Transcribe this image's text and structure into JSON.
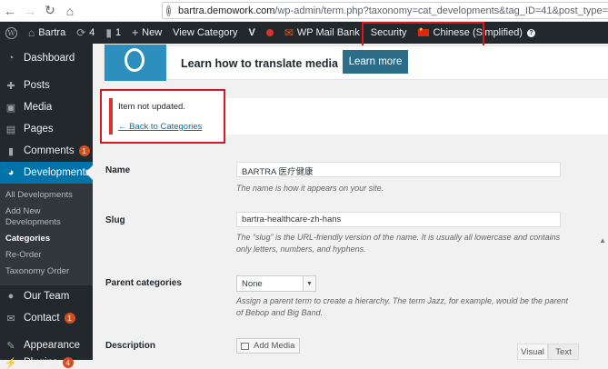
{
  "browser": {
    "url_host": "bartra.demowork.com",
    "url_path": "/wp-admin/term.php?taxonomy=cat_developments&tag_ID=41&post_type=developments"
  },
  "adminbar": {
    "site_name": "Bartra",
    "updates_count": "4",
    "comments_count": "1",
    "new_label": "New",
    "view_category": "View Category",
    "mail_bank": "WP Mail Bank",
    "security": "Security",
    "language": "Chinese (Simplified)"
  },
  "sidebar": {
    "dashboard": "Dashboard",
    "posts": "Posts",
    "media": "Media",
    "pages": "Pages",
    "comments": "Comments",
    "comments_badge": "1",
    "developments": "Developments",
    "sub": [
      "All Developments",
      "Add New Developments",
      "Categories",
      "Re-Order",
      "Taxonomy Order"
    ],
    "our_team": "Our Team",
    "contact": "Contact",
    "contact_badge": "1",
    "appearance": "Appearance",
    "plugins": "Plugins",
    "plugins_badge": "4"
  },
  "promo": {
    "text": "Learn how to translate media",
    "button": "Learn more"
  },
  "notice": {
    "message": "Item not updated.",
    "back_link": "← Back to Categories"
  },
  "form": {
    "name_label": "Name",
    "name_value": "BARTRA 医疗健康",
    "name_desc": "The name is how it appears on your site.",
    "slug_label": "Slug",
    "slug_value": "bartra-healthcare-zh-hans",
    "slug_desc_1": "The “slug” is the URL-friendly version of the name. It is usually all lowercase and contains",
    "slug_desc_2": "only letters, numbers, and hyphens.",
    "parent_label": "Parent categories",
    "parent_value": "None",
    "parent_desc_1": "Assign a parent term to create a hierarchy. The term Jazz, for example, would be the parent",
    "parent_desc_2": "of Bebop and Big Band.",
    "description_label": "Description",
    "add_media": "Add Media",
    "tab_visual": "Visual",
    "tab_text": "Text"
  }
}
